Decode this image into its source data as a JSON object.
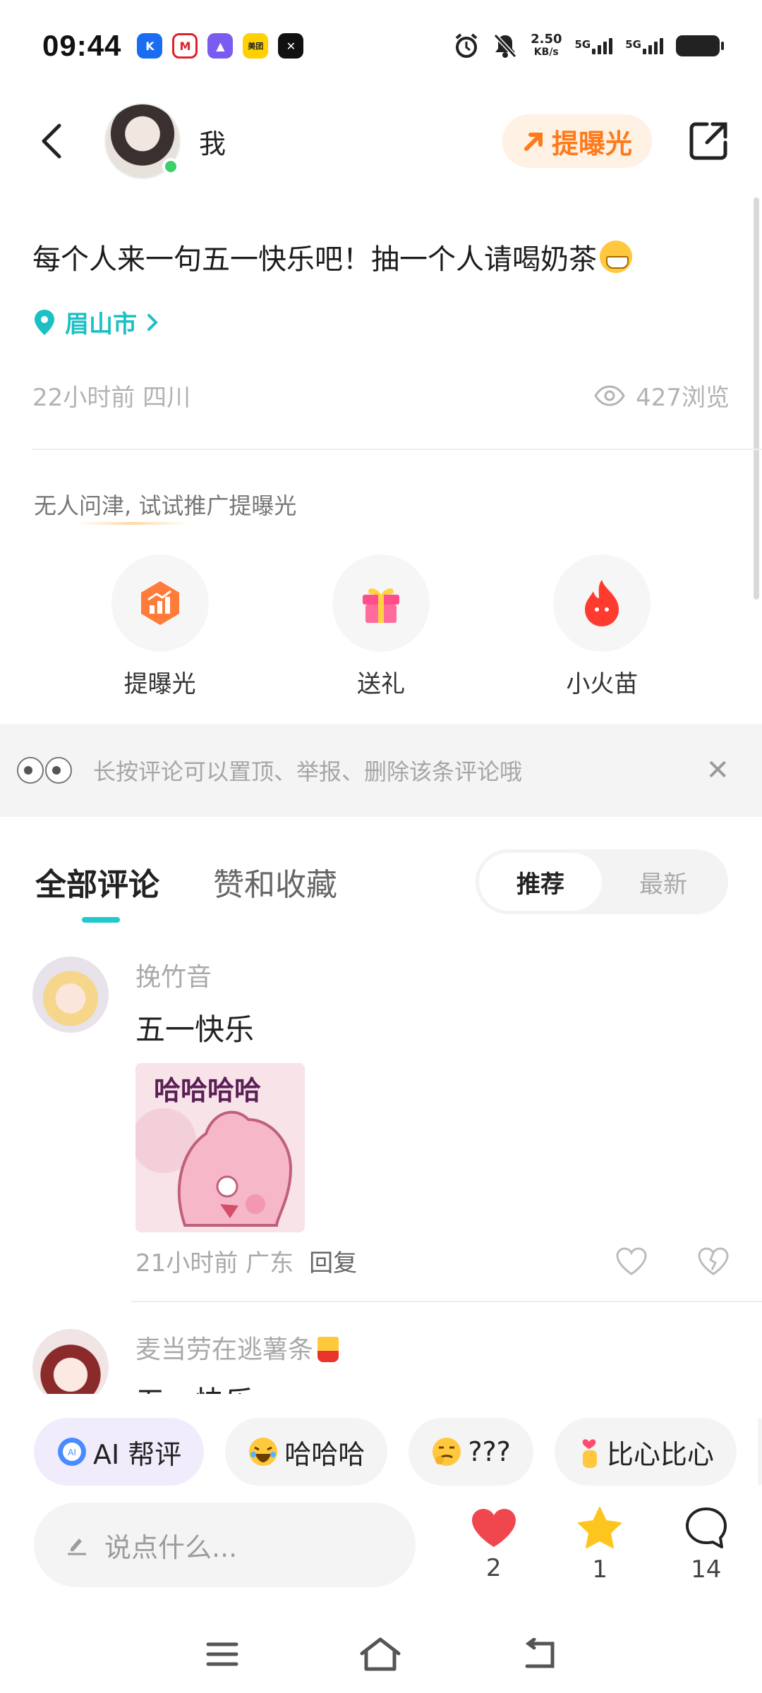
{
  "status_bar": {
    "time": "09:44",
    "net_speed_value": "2.50",
    "net_speed_unit": "KB/s",
    "sim1": "5G",
    "sim2": "5G",
    "meituan_label": "美团"
  },
  "header": {
    "username": "我",
    "expose_button_label": "提曝光"
  },
  "post": {
    "text": "每个人来一句五一快乐吧！抽一个人请喝奶茶",
    "location": "眉山市",
    "time_region": "22小时前 四川",
    "views": "427浏览"
  },
  "promotion": {
    "hint": "无人问津, 试试推广提曝光",
    "actions": [
      {
        "label": "提曝光",
        "icon": "expose-chart-icon"
      },
      {
        "label": "送礼",
        "icon": "gift-icon"
      },
      {
        "label": "小火苗",
        "icon": "flame-icon"
      }
    ]
  },
  "tip": {
    "text": "长按评论可以置顶、举报、删除该条评论哦"
  },
  "tabs": {
    "all_comments": "全部评论",
    "likes_favorites": "赞和收藏",
    "sort_recommended": "推荐",
    "sort_latest": "最新"
  },
  "comments": [
    {
      "user": "挽竹音",
      "text": "五一快乐",
      "sticker_text": "哈哈哈哈",
      "time_region": "21小时前 广东",
      "reply_label": "回复"
    },
    {
      "user": "麦当劳在逃薯条",
      "text": "五一快乐"
    }
  ],
  "quick_replies": [
    {
      "label": "AI 帮评",
      "icon": "ai-icon"
    },
    {
      "label": "哈哈哈",
      "icon": "laughing-emoji-icon"
    },
    {
      "label": "???",
      "icon": "confused-emoji-icon"
    },
    {
      "label": "比心比心",
      "icon": "finger-heart-icon"
    }
  ],
  "input": {
    "placeholder": "说点什么..."
  },
  "stats": {
    "likes": "2",
    "favorites": "1",
    "comments": "14"
  },
  "colors": {
    "accent": "#22c8cc",
    "expose_orange": "#ff7a1a",
    "like_red": "#f0474f",
    "star_yellow": "#ffc51f"
  }
}
